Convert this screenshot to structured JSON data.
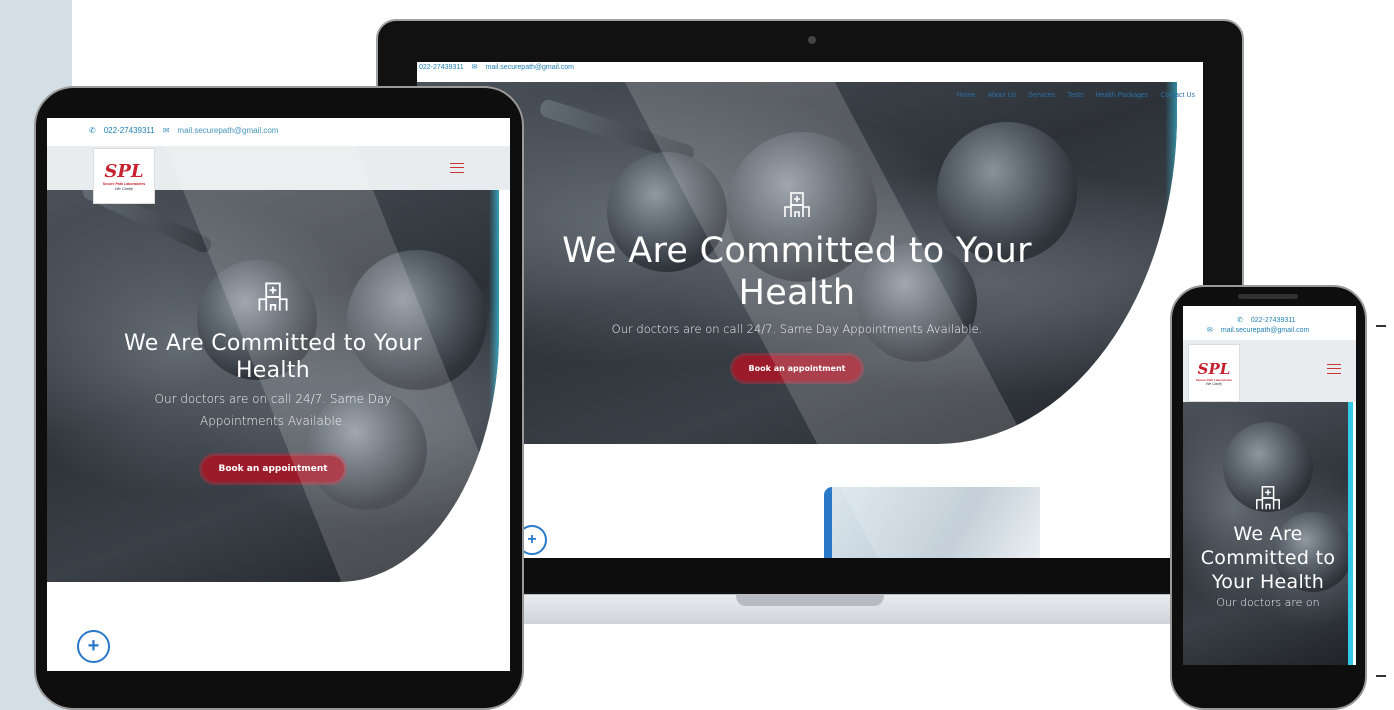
{
  "site": {
    "phone": "022-27439311",
    "email": "mail.securepath@gmail.com",
    "logo_letters": "SPL",
    "logo_name": "Secure Path Laboratories",
    "logo_tagline": "We Clarify"
  },
  "nav": {
    "items": [
      "Home",
      "About Us",
      "Services",
      "Tests",
      "Health Packages",
      "Contact Us"
    ]
  },
  "hero": {
    "title_laptop": "We Are Committed to Your Health",
    "title_tablet": "We Are Committed to Your Health",
    "title_phone": "We Are Committed to Your Health",
    "subtitle": "Our doctors are on call 24/7. Same Day Appointments Available.",
    "subtitle_phone": "Our doctors are on",
    "cta": "Book an appointment"
  },
  "icons": {
    "phone": "phone-icon",
    "email": "envelope-icon",
    "hero": "hospital-building-icon",
    "floating": "plus-circle-icon",
    "menu": "hamburger-menu-icon"
  },
  "colors": {
    "brand_red": "#9b1b2a",
    "link_blue": "#1f7fb2",
    "accent_cyan": "#35c7e6",
    "side_band": "#d3dfe4"
  }
}
